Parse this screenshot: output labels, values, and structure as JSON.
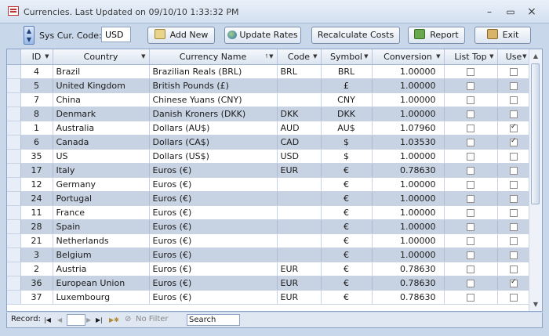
{
  "window": {
    "title": "Currencies. Last Updated on 09/10/10 1:33:32 PM"
  },
  "toolbar": {
    "sys_label": "Sys Cur. Code:",
    "sys_code": "USD",
    "add_label": "Add New",
    "update_label": "Update Rates",
    "recalc_label": "Recalculate Costs",
    "report_label": "Report",
    "exit_label": "Exit"
  },
  "columns": [
    "ID",
    "Country",
    "Currency Name",
    "Code",
    "Symbol",
    "Conversion",
    "List Top",
    "Use"
  ],
  "rows": [
    {
      "id": "4",
      "country": "Brazil",
      "currency": "Brazilian Reals (BRL)",
      "code": "BRL",
      "symbol": "BRL",
      "conversion": "1.00000",
      "list_top": false,
      "use": false
    },
    {
      "id": "5",
      "country": "United Kingdom",
      "currency": "British Pounds (£)",
      "code": "",
      "symbol": "£",
      "conversion": "1.00000",
      "list_top": false,
      "use": false
    },
    {
      "id": "7",
      "country": "China",
      "currency": "Chinese Yuans (CNY)",
      "code": "",
      "symbol": "CNY",
      "conversion": "1.00000",
      "list_top": false,
      "use": false
    },
    {
      "id": "8",
      "country": "Denmark",
      "currency": "Danish Kroners (DKK)",
      "code": "DKK",
      "symbol": "DKK",
      "conversion": "1.00000",
      "list_top": false,
      "use": false
    },
    {
      "id": "1",
      "country": "Australia",
      "currency": "Dollars (AU$)",
      "code": "AUD",
      "symbol": "AU$",
      "conversion": "1.07960",
      "list_top": false,
      "use": true
    },
    {
      "id": "6",
      "country": "Canada",
      "currency": "Dollars (CA$)",
      "code": "CAD",
      "symbol": "$",
      "conversion": "1.03530",
      "list_top": false,
      "use": true
    },
    {
      "id": "35",
      "country": "US",
      "currency": "Dollars (US$)",
      "code": "USD",
      "symbol": "$",
      "conversion": "1.00000",
      "list_top": false,
      "use": false
    },
    {
      "id": "17",
      "country": "Italy",
      "currency": "Euros (€)",
      "code": "EUR",
      "symbol": "€",
      "conversion": "0.78630",
      "list_top": false,
      "use": false
    },
    {
      "id": "12",
      "country": "Germany",
      "currency": "Euros (€)",
      "code": "",
      "symbol": "€",
      "conversion": "1.00000",
      "list_top": false,
      "use": false
    },
    {
      "id": "24",
      "country": "Portugal",
      "currency": "Euros (€)",
      "code": "",
      "symbol": "€",
      "conversion": "1.00000",
      "list_top": false,
      "use": false
    },
    {
      "id": "11",
      "country": "France",
      "currency": "Euros (€)",
      "code": "",
      "symbol": "€",
      "conversion": "1.00000",
      "list_top": false,
      "use": false
    },
    {
      "id": "28",
      "country": "Spain",
      "currency": "Euros (€)",
      "code": "",
      "symbol": "€",
      "conversion": "1.00000",
      "list_top": false,
      "use": false
    },
    {
      "id": "21",
      "country": "Netherlands",
      "currency": "Euros (€)",
      "code": "",
      "symbol": "€",
      "conversion": "1.00000",
      "list_top": false,
      "use": false
    },
    {
      "id": "3",
      "country": "Belgium",
      "currency": "Euros (€)",
      "code": "",
      "symbol": "€",
      "conversion": "1.00000",
      "list_top": false,
      "use": false
    },
    {
      "id": "2",
      "country": "Austria",
      "currency": "Euros (€)",
      "code": "EUR",
      "symbol": "€",
      "conversion": "0.78630",
      "list_top": false,
      "use": false
    },
    {
      "id": "36",
      "country": "European Union",
      "currency": "Euros (€)",
      "code": "EUR",
      "symbol": "€",
      "conversion": "0.78630",
      "list_top": false,
      "use": true
    },
    {
      "id": "37",
      "country": "Luxembourg",
      "currency": "Euros (€)",
      "code": "EUR",
      "symbol": "€",
      "conversion": "0.78630",
      "list_top": false,
      "use": false
    }
  ],
  "nav": {
    "record_label": "Record:",
    "no_filter_label": "No Filter",
    "search_label": "Search"
  },
  "colors": {
    "row_alt": "#c7d2e2",
    "header": "#dbe4f0",
    "border": "#8aa3c6"
  }
}
